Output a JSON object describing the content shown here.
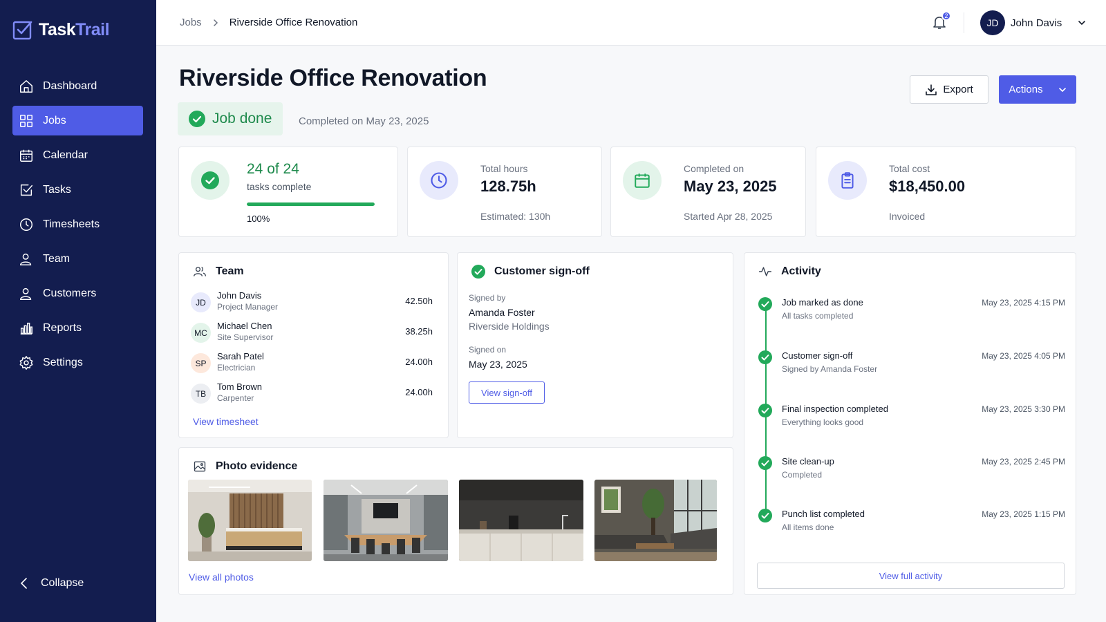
{
  "app": {
    "name_part1": "Task",
    "name_part2": "Trail",
    "accent": "#4f5ce6",
    "sidebar_bg": "#131d4f"
  },
  "sidebar": {
    "items": [
      {
        "label": "Dashboard",
        "icon": "home-icon"
      },
      {
        "label": "Jobs",
        "icon": "grid-icon",
        "active": true
      },
      {
        "label": "Calendar",
        "icon": "calendar-icon"
      },
      {
        "label": "Tasks",
        "icon": "checkbox-icon"
      },
      {
        "label": "Timesheets",
        "icon": "clock-icon"
      },
      {
        "label": "Team",
        "icon": "user-icon"
      },
      {
        "label": "Customers",
        "icon": "user-icon"
      },
      {
        "label": "Reports",
        "icon": "bar-chart-icon"
      },
      {
        "label": "Settings",
        "icon": "gear-icon"
      }
    ],
    "collapse_label": "Collapse"
  },
  "topbar": {
    "breadcrumb": {
      "parent": "Jobs",
      "current": "Riverside Office Renovation"
    },
    "notifications_count": "2",
    "user": {
      "initials": "JD",
      "name": "John Davis"
    }
  },
  "header": {
    "title": "Riverside Office Renovation",
    "status": "Job done",
    "completed_text": "Completed on May 23, 2025",
    "export_label": "Export",
    "actions_label": "Actions"
  },
  "stats": {
    "tasks": {
      "value": "24 of 24",
      "label": "tasks complete",
      "percent_label": "100%",
      "progress": 1.0
    },
    "hours": {
      "label": "Total hours",
      "value": "128.75h",
      "sub": "Estimated: 130h"
    },
    "completed": {
      "label": "Completed on",
      "value": "May 23, 2025",
      "sub": "Started Apr 28, 2025"
    },
    "cost": {
      "label": "Total cost",
      "value": "$18,450.00",
      "sub": "Invoiced"
    }
  },
  "team": {
    "title": "Team",
    "members": [
      {
        "initials": "JD",
        "name": "John Davis",
        "role": "Project Manager",
        "hours": "42.50h",
        "color": "#e8eafc"
      },
      {
        "initials": "MC",
        "name": "Michael Chen",
        "role": "Site Supervisor",
        "hours": "38.25h",
        "color": "#e3f4ea"
      },
      {
        "initials": "SP",
        "name": "Sarah Patel",
        "role": "Electrician",
        "hours": "24.00h",
        "color": "#fde8dc"
      },
      {
        "initials": "TB",
        "name": "Tom Brown",
        "role": "Carpenter",
        "hours": "24.00h",
        "color": "#eceef2"
      }
    ],
    "link_label": "View timesheet"
  },
  "signoff": {
    "title": "Customer sign-off",
    "signed_by_label": "Signed by",
    "signer_name": "Amanda Foster",
    "signer_company": "Riverside Holdings",
    "signed_on_label": "Signed on",
    "signed_on": "May 23, 2025",
    "button_label": "View sign-off"
  },
  "photos": {
    "title": "Photo evidence",
    "link_label": "View all photos"
  },
  "activity": {
    "title": "Activity",
    "items": [
      {
        "title": "Job marked as done",
        "sub": "All tasks completed",
        "time": "May 23, 2025  4:15 PM"
      },
      {
        "title": "Customer sign-off",
        "sub": "Signed by Amanda Foster",
        "time": "May 23, 2025  4:05 PM"
      },
      {
        "title": "Final inspection completed",
        "sub": "Everything looks good",
        "time": "May 23, 2025  3:30 PM"
      },
      {
        "title": "Site clean-up",
        "sub": "Completed",
        "time": "May 23, 2025  2:45 PM"
      },
      {
        "title": "Punch list completed",
        "sub": "All items done",
        "time": "May 23, 2025  1:15 PM"
      }
    ],
    "button_label": "View full activity"
  }
}
